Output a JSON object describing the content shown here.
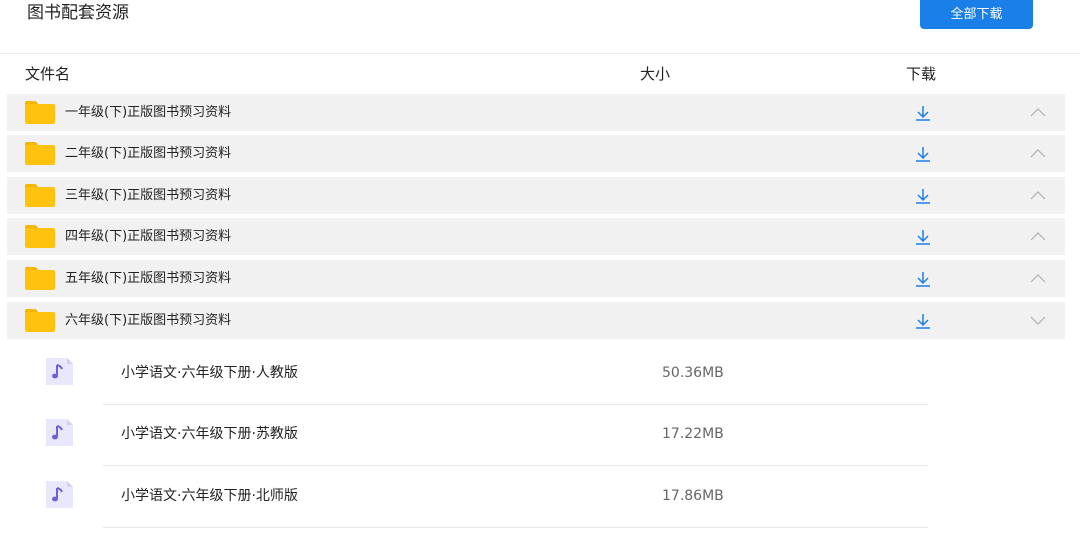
{
  "header": {
    "title": "图书配套资源",
    "download_all_label": "全部下载",
    "accent_color": "#1a7fe8"
  },
  "columns": {
    "name": "文件名",
    "size": "大小",
    "download": "下载"
  },
  "folders": [
    {
      "name": "一年级(下)正版图书预习资料",
      "expanded": false
    },
    {
      "name": "二年级(下)正版图书预习资料",
      "expanded": false
    },
    {
      "name": "三年级(下)正版图书预习资料",
      "expanded": false
    },
    {
      "name": "四年级(下)正版图书预习资料",
      "expanded": false
    },
    {
      "name": "五年级(下)正版图书预习资料",
      "expanded": false
    },
    {
      "name": "六年级(下)正版图书预习资料",
      "expanded": true
    }
  ],
  "files": [
    {
      "name": "小学语文·六年级下册·人教版",
      "size": "50.36MB",
      "icon": "music-note-icon"
    },
    {
      "name": "小学语文·六年级下册·苏教版",
      "size": "17.22MB",
      "icon": "music-note-icon"
    },
    {
      "name": "小学语文·六年级下册·北师版",
      "size": "17.86MB",
      "icon": "music-note-icon"
    }
  ],
  "icons": {
    "folder": "folder-icon",
    "download": "download-icon",
    "collapse": "chevron-up-icon",
    "expand": "chevron-down-icon"
  }
}
